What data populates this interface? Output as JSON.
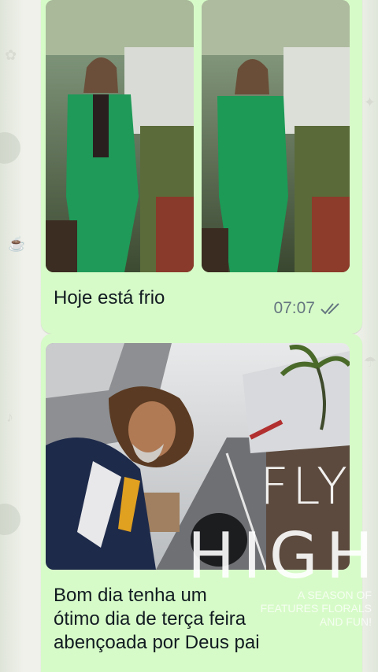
{
  "messages": [
    {
      "caption": "Hoje está frio",
      "time": "07:07",
      "status_icon": "double-check-icon",
      "photos": [
        "photo-left",
        "photo-right"
      ]
    },
    {
      "caption_lines": [
        "Bom dia tenha um",
        "ótimo dia de terça feira",
        "abençoada por Deus pai"
      ],
      "photo": "selfie-photo"
    }
  ],
  "overlay": {
    "line1": "FLY",
    "line2": "HIGH",
    "small": [
      "A SEASON OF",
      "FEATURES FLORALS",
      "AND FUN!"
    ]
  },
  "colors": {
    "bubble": "#d7fbc8",
    "chat_bg": "#eff1ea",
    "meta_text": "#667781",
    "tick": "#667781"
  }
}
